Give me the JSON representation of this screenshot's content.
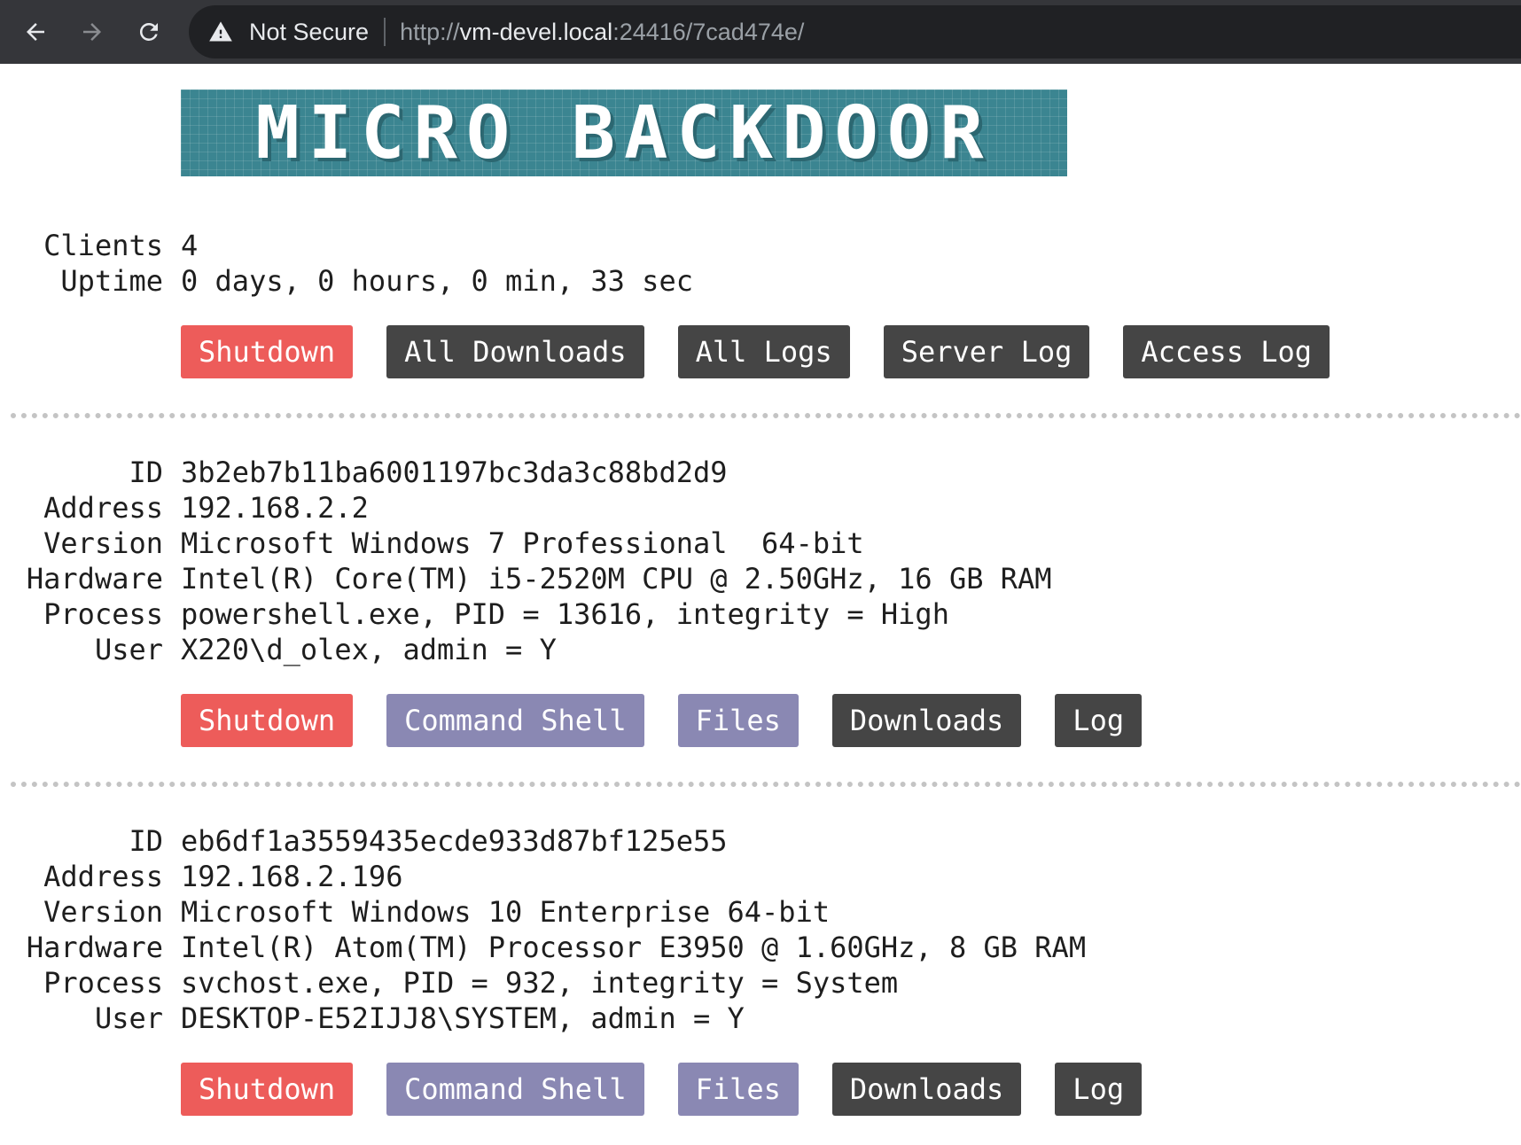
{
  "browser": {
    "security_label": "Not Secure",
    "url_scheme": "http://",
    "url_host": "vm-devel.local",
    "url_rest": ":24416/7cad474e/"
  },
  "logo": {
    "text": "MICRO BACKDOOR"
  },
  "server": {
    "rows": [
      {
        "label": "Clients",
        "value": "4"
      },
      {
        "label": "Uptime",
        "value": "0 days, 0 hours, 0 min, 33 sec"
      }
    ],
    "buttons": [
      "Shutdown",
      "All Downloads",
      "All Logs",
      "Server Log",
      "Access Log"
    ]
  },
  "clients": [
    {
      "rows": [
        {
          "label": "ID",
          "value": "3b2eb7b11ba6001197bc3da3c88bd2d9"
        },
        {
          "label": "Address",
          "value": "192.168.2.2"
        },
        {
          "label": "Version",
          "value": "Microsoft Windows 7 Professional  64-bit"
        },
        {
          "label": "Hardware",
          "value": "Intel(R) Core(TM) i5-2520M CPU @ 2.50GHz, 16 GB RAM"
        },
        {
          "label": "Process",
          "value": "powershell.exe, PID = 13616, integrity = High"
        },
        {
          "label": "User",
          "value": "X220\\d_olex, admin = Y"
        }
      ],
      "buttons": [
        "Shutdown",
        "Command Shell",
        "Files",
        "Downloads",
        "Log"
      ]
    },
    {
      "rows": [
        {
          "label": "ID",
          "value": "eb6df1a3559435ecde933d87bf125e55"
        },
        {
          "label": "Address",
          "value": "192.168.2.196"
        },
        {
          "label": "Version",
          "value": "Microsoft Windows 10 Enterprise 64-bit"
        },
        {
          "label": "Hardware",
          "value": "Intel(R) Atom(TM) Processor E3950 @ 1.60GHz, 8 GB RAM"
        },
        {
          "label": "Process",
          "value": "svchost.exe, PID = 932, integrity = System"
        },
        {
          "label": "User",
          "value": "DESKTOP-E52IJJ8\\SYSTEM, admin = Y"
        }
      ],
      "buttons": [
        "Shutdown",
        "Command Shell",
        "Files",
        "Downloads",
        "Log"
      ]
    }
  ],
  "colors": {
    "shutdown": "#ed5c5a",
    "action": "#454545",
    "interactive": "#8a88b3",
    "logo_bg": "#3b8591",
    "chrome_bg": "#35363a"
  }
}
